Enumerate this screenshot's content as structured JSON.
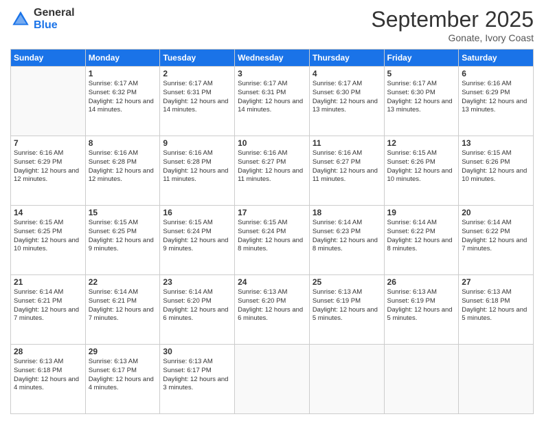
{
  "logo": {
    "general": "General",
    "blue": "Blue"
  },
  "header": {
    "month": "September 2025",
    "location": "Gonate, Ivory Coast"
  },
  "weekdays": [
    "Sunday",
    "Monday",
    "Tuesday",
    "Wednesday",
    "Thursday",
    "Friday",
    "Saturday"
  ],
  "weeks": [
    [
      {
        "day": null
      },
      {
        "day": "1",
        "sunrise": "6:17 AM",
        "sunset": "6:32 PM",
        "daylight": "12 hours and 14 minutes."
      },
      {
        "day": "2",
        "sunrise": "6:17 AM",
        "sunset": "6:31 PM",
        "daylight": "12 hours and 14 minutes."
      },
      {
        "day": "3",
        "sunrise": "6:17 AM",
        "sunset": "6:31 PM",
        "daylight": "12 hours and 14 minutes."
      },
      {
        "day": "4",
        "sunrise": "6:17 AM",
        "sunset": "6:30 PM",
        "daylight": "12 hours and 13 minutes."
      },
      {
        "day": "5",
        "sunrise": "6:17 AM",
        "sunset": "6:30 PM",
        "daylight": "12 hours and 13 minutes."
      },
      {
        "day": "6",
        "sunrise": "6:16 AM",
        "sunset": "6:29 PM",
        "daylight": "12 hours and 13 minutes."
      }
    ],
    [
      {
        "day": "7",
        "sunrise": "6:16 AM",
        "sunset": "6:29 PM",
        "daylight": "12 hours and 12 minutes."
      },
      {
        "day": "8",
        "sunrise": "6:16 AM",
        "sunset": "6:28 PM",
        "daylight": "12 hours and 12 minutes."
      },
      {
        "day": "9",
        "sunrise": "6:16 AM",
        "sunset": "6:28 PM",
        "daylight": "12 hours and 11 minutes."
      },
      {
        "day": "10",
        "sunrise": "6:16 AM",
        "sunset": "6:27 PM",
        "daylight": "12 hours and 11 minutes."
      },
      {
        "day": "11",
        "sunrise": "6:16 AM",
        "sunset": "6:27 PM",
        "daylight": "12 hours and 11 minutes."
      },
      {
        "day": "12",
        "sunrise": "6:15 AM",
        "sunset": "6:26 PM",
        "daylight": "12 hours and 10 minutes."
      },
      {
        "day": "13",
        "sunrise": "6:15 AM",
        "sunset": "6:26 PM",
        "daylight": "12 hours and 10 minutes."
      }
    ],
    [
      {
        "day": "14",
        "sunrise": "6:15 AM",
        "sunset": "6:25 PM",
        "daylight": "12 hours and 10 minutes."
      },
      {
        "day": "15",
        "sunrise": "6:15 AM",
        "sunset": "6:25 PM",
        "daylight": "12 hours and 9 minutes."
      },
      {
        "day": "16",
        "sunrise": "6:15 AM",
        "sunset": "6:24 PM",
        "daylight": "12 hours and 9 minutes."
      },
      {
        "day": "17",
        "sunrise": "6:15 AM",
        "sunset": "6:24 PM",
        "daylight": "12 hours and 8 minutes."
      },
      {
        "day": "18",
        "sunrise": "6:14 AM",
        "sunset": "6:23 PM",
        "daylight": "12 hours and 8 minutes."
      },
      {
        "day": "19",
        "sunrise": "6:14 AM",
        "sunset": "6:22 PM",
        "daylight": "12 hours and 8 minutes."
      },
      {
        "day": "20",
        "sunrise": "6:14 AM",
        "sunset": "6:22 PM",
        "daylight": "12 hours and 7 minutes."
      }
    ],
    [
      {
        "day": "21",
        "sunrise": "6:14 AM",
        "sunset": "6:21 PM",
        "daylight": "12 hours and 7 minutes."
      },
      {
        "day": "22",
        "sunrise": "6:14 AM",
        "sunset": "6:21 PM",
        "daylight": "12 hours and 7 minutes."
      },
      {
        "day": "23",
        "sunrise": "6:14 AM",
        "sunset": "6:20 PM",
        "daylight": "12 hours and 6 minutes."
      },
      {
        "day": "24",
        "sunrise": "6:13 AM",
        "sunset": "6:20 PM",
        "daylight": "12 hours and 6 minutes."
      },
      {
        "day": "25",
        "sunrise": "6:13 AM",
        "sunset": "6:19 PM",
        "daylight": "12 hours and 5 minutes."
      },
      {
        "day": "26",
        "sunrise": "6:13 AM",
        "sunset": "6:19 PM",
        "daylight": "12 hours and 5 minutes."
      },
      {
        "day": "27",
        "sunrise": "6:13 AM",
        "sunset": "6:18 PM",
        "daylight": "12 hours and 5 minutes."
      }
    ],
    [
      {
        "day": "28",
        "sunrise": "6:13 AM",
        "sunset": "6:18 PM",
        "daylight": "12 hours and 4 minutes."
      },
      {
        "day": "29",
        "sunrise": "6:13 AM",
        "sunset": "6:17 PM",
        "daylight": "12 hours and 4 minutes."
      },
      {
        "day": "30",
        "sunrise": "6:13 AM",
        "sunset": "6:17 PM",
        "daylight": "12 hours and 3 minutes."
      },
      {
        "day": null
      },
      {
        "day": null
      },
      {
        "day": null
      },
      {
        "day": null
      }
    ]
  ]
}
